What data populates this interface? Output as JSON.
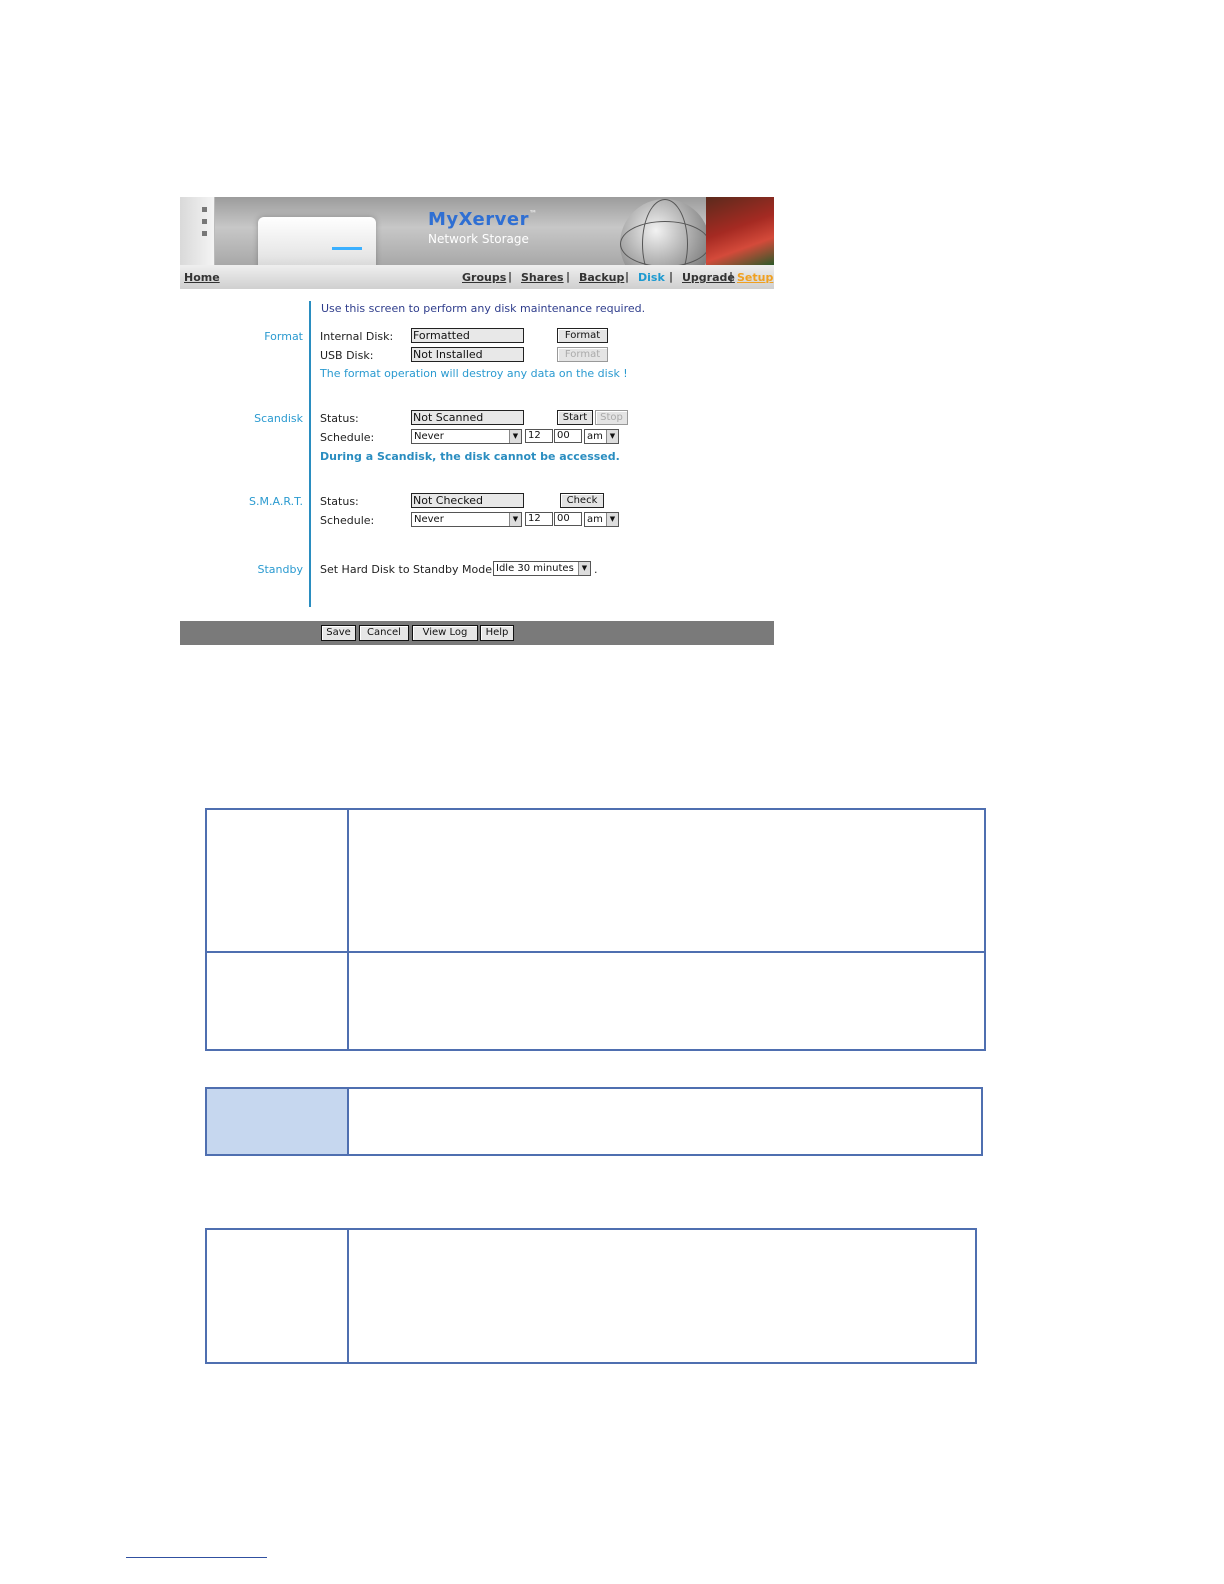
{
  "banner": {
    "brand": "MyXerver",
    "trademark": "™",
    "subtitle": "Network Storage"
  },
  "nav": {
    "home": "Home",
    "groups": "Groups",
    "shares": "Shares",
    "backup": "Backup",
    "disk": "Disk",
    "upgrade": "Upgrade",
    "setup": "Setup",
    "separator": "|",
    "active_color": "#1e9ad0",
    "setup_color": "#f0a020"
  },
  "intro": "Use this screen to perform any disk maintenance required.",
  "format": {
    "section": "Format",
    "internal_label": "Internal Disk:",
    "internal_value": "Formatted",
    "internal_button": "Format",
    "usb_label": "USB Disk:",
    "usb_value": "Not Installed",
    "usb_button": "Format",
    "warning": "The format operation will destroy any data on the disk !"
  },
  "scandisk": {
    "section": "Scandisk",
    "status_label": "Status:",
    "status_value": "Not Scanned",
    "start_button": "Start",
    "stop_button": "Stop",
    "schedule_label": "Schedule:",
    "schedule_value": "Never",
    "hour": "12",
    "minute": "00",
    "ampm": "am",
    "note": "During a Scandisk, the disk cannot be accessed."
  },
  "smart": {
    "section": "S.M.A.R.T.",
    "status_label": "Status:",
    "status_value": "Not Checked",
    "check_button": "Check",
    "schedule_label": "Schedule:",
    "schedule_value": "Never",
    "hour": "12",
    "minute": "00",
    "ampm": "am"
  },
  "standby": {
    "section": "Standby",
    "text": "Set Hard Disk to Standby Mode after",
    "value": "Idle 30 minutes",
    "trailing": "."
  },
  "footer": {
    "save": "Save",
    "cancel": "Cancel",
    "view_log": "View Log",
    "help": "Help"
  },
  "colors": {
    "table_border": "#4f6fb0",
    "note_fill": "#c6d7ef",
    "accent": "#2a9ad0"
  }
}
